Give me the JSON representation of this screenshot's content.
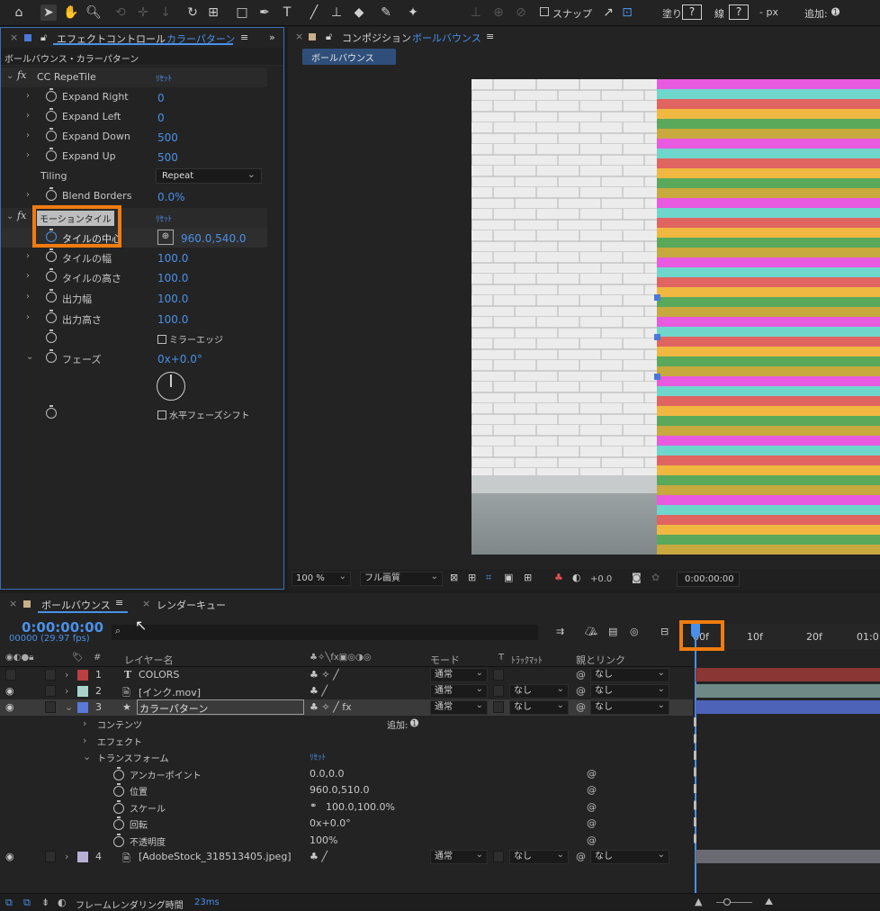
{
  "toolbar": {
    "snap_label": "スナップ",
    "fill_label": "塗り",
    "fill_value": "?",
    "stroke_label": "線",
    "stroke_value": "?",
    "stroke_unit": "- px",
    "add_label": "追加:"
  },
  "effect_panel": {
    "tab_title": "エフェクトコントロール",
    "tab_layer": "カラーパターン",
    "breadcrumb": "ボールバウンス・カラーパターン",
    "reset_label": "ﾘｾｯﾄ",
    "effects": [
      {
        "name": "CC RepeTile",
        "props": [
          {
            "label": "Expand Right",
            "value": "0"
          },
          {
            "label": "Expand Left",
            "value": "0"
          },
          {
            "label": "Expand Down",
            "value": "500"
          },
          {
            "label": "Expand Up",
            "value": "500"
          },
          {
            "label": "Tiling",
            "value": "Repeat"
          },
          {
            "label": "Blend Borders",
            "value": "0.0%"
          }
        ]
      },
      {
        "name": "モーションタイル",
        "props": [
          {
            "label": "タイルの中心",
            "value": "960.0,540.0"
          },
          {
            "label": "タイルの幅",
            "value": "100.0"
          },
          {
            "label": "タイルの高さ",
            "value": "100.0"
          },
          {
            "label": "出力幅",
            "value": "100.0"
          },
          {
            "label": "出力高さ",
            "value": "100.0"
          },
          {
            "label": "",
            "value": "ミラーエッジ"
          },
          {
            "label": "フェーズ",
            "value": "0x+0.0°"
          },
          {
            "label": "",
            "value": "水平フェーズシフト"
          }
        ]
      }
    ]
  },
  "comp_panel": {
    "tab_title": "コンポジション",
    "tab_comp": "ボールバウンス",
    "comp_button": "ボールバウンス",
    "zoom": "100 %",
    "quality": "フル画質",
    "exposure": "+0.0",
    "timecode": "0:00:00:00",
    "stripe_colors": [
      "#e85adf",
      "#6fd6cc",
      "#e06460",
      "#f0b840",
      "#5aa85a",
      "#c7a93e"
    ]
  },
  "timeline": {
    "tab_comp": "ボールバウンス",
    "tab_render": "レンダーキュー",
    "timecode": "0:00:00:00",
    "frame_info": "00000 (29.97 fps)",
    "ruler": [
      "00f",
      "10f",
      "20f",
      "01:0"
    ],
    "headers": {
      "layer_name": "レイヤー名",
      "mode": "モード",
      "track_matte_t": "T",
      "track_matte": "ﾄﾗｯｸﾏｯﾄ",
      "parent": "親とリンク"
    },
    "layers": [
      {
        "num": "1",
        "name": "COLORS",
        "mode": "通常",
        "matte": "",
        "parent": "なし",
        "color": "#b8413f",
        "bar": "#8a3634"
      },
      {
        "num": "2",
        "name": "[インク.mov]",
        "mode": "通常",
        "matte": "なし",
        "parent": "なし",
        "color": "#a8d4cc",
        "bar": "#6f8a86"
      },
      {
        "num": "3",
        "name": "カラーパターン",
        "mode": "通常",
        "matte": "なし",
        "parent": "なし",
        "color": "#5a78d8",
        "bar": "#4c63b8"
      }
    ],
    "sub_rows": {
      "contents": "コンテンツ",
      "add_label": "追加:",
      "effects": "エフェクト",
      "transform": "トランスフォーム",
      "reset_label": "ﾘｾｯﾄ",
      "props": [
        {
          "label": "アンカーポイント",
          "value": "0.0,0.0"
        },
        {
          "label": "位置",
          "value": "960.0,510.0"
        },
        {
          "label": "スケール",
          "value": "100.0,100.0%"
        },
        {
          "label": "回転",
          "value": "0x+0.0°"
        },
        {
          "label": "不透明度",
          "value": "100%"
        }
      ]
    },
    "layer4": {
      "num": "4",
      "name": "[AdobeStock_318513405.jpeg]",
      "mode": "通常",
      "matte": "なし",
      "parent": "なし",
      "color": "#b8b0d4"
    },
    "status": "フレームレンダリング時間",
    "render_time": "23ms"
  }
}
